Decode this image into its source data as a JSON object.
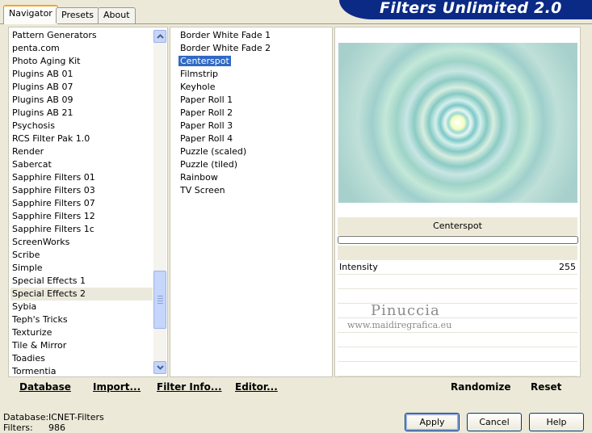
{
  "banner": {
    "title": "Filters Unlimited 2.0"
  },
  "tabs": [
    {
      "label": "Navigator",
      "active": true
    },
    {
      "label": "Presets",
      "active": false
    },
    {
      "label": "About",
      "active": false
    }
  ],
  "categories": {
    "items": [
      "Pattern Generators",
      "penta.com",
      "Photo Aging Kit",
      "Plugins AB 01",
      "Plugins AB 07",
      "Plugins AB 09",
      "Plugins AB 21",
      "Psychosis",
      "RCS Filter Pak 1.0",
      "Render",
      "Sabercat",
      "Sapphire Filters 01",
      "Sapphire Filters 03",
      "Sapphire Filters 07",
      "Sapphire Filters 12",
      "Sapphire Filters 1c",
      "ScreenWorks",
      "Scribe",
      "Simple",
      "Special Effects 1",
      "Special Effects 2",
      "Sybia",
      "Teph's Tricks",
      "Texturize",
      "Tile & Mirror",
      "Toadies",
      "Tormentia"
    ],
    "selected": "Special Effects 2"
  },
  "filters": {
    "items": [
      "Border White Fade 1",
      "Border White Fade 2",
      "Centerspot",
      "Filmstrip",
      "Keyhole",
      "Paper Roll 1",
      "Paper Roll 2",
      "Paper Roll 3",
      "Paper Roll 4",
      "Puzzle (scaled)",
      "Puzzle (tiled)",
      "Rainbow",
      "TV Screen"
    ],
    "selected": "Centerspot"
  },
  "preview": {
    "filter_name": "Centerspot",
    "params": [
      {
        "label": "Intensity",
        "value": "255"
      }
    ],
    "watermark_name": "Pinuccia",
    "watermark_url": "www.maidiregrafica.eu"
  },
  "toolbar": {
    "database": "Database",
    "import": "Import...",
    "filter_info": "Filter Info...",
    "editor": "Editor...",
    "randomize": "Randomize",
    "reset": "Reset"
  },
  "status": {
    "database_label": "Database:",
    "database_value": "ICNET-Filters",
    "filters_label": "Filters:",
    "filters_value": "986"
  },
  "buttons": {
    "apply": "Apply",
    "cancel": "Cancel",
    "help": "Help"
  },
  "colors": {
    "banner": "#0b2a86",
    "selection": "#316ac5",
    "window": "#ece9d8"
  }
}
